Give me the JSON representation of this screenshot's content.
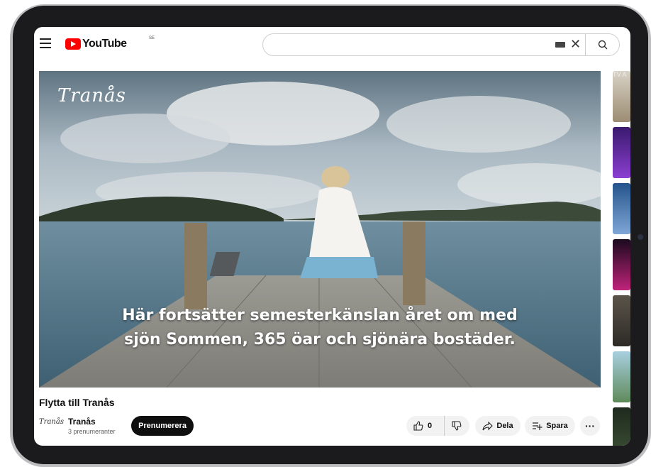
{
  "header": {
    "logo_text": "YouTube",
    "country_code": "SE",
    "search_placeholder": ""
  },
  "player": {
    "brand_overlay": "Tranås",
    "caption_line1": "Här fortsätter semesterkänslan året om med",
    "caption_line2": "sjön Sommen, 365 öar och sjönära bostäder."
  },
  "side_rail": {
    "partial_label": "TV A"
  },
  "video": {
    "title": "Flytta till Tranås",
    "channel_avatar_text": "Tranås",
    "channel_name": "Tranås",
    "subscribers": "3 prenumeranter",
    "subscribe_label": "Prenumerera",
    "like_count": "0",
    "share_label": "Dela",
    "save_label": "Spara",
    "more_label": "···"
  },
  "colors": {
    "brand_red": "#ff0000",
    "subscribe_bg": "#0f0f0f",
    "pill_bg": "#f2f2f2"
  },
  "icons": [
    "menu-icon",
    "youtube-play-icon",
    "keyboard-icon",
    "clear-icon",
    "search-icon",
    "thumbs-up-icon",
    "thumbs-down-icon",
    "share-icon",
    "save-playlist-icon",
    "more-icon"
  ]
}
